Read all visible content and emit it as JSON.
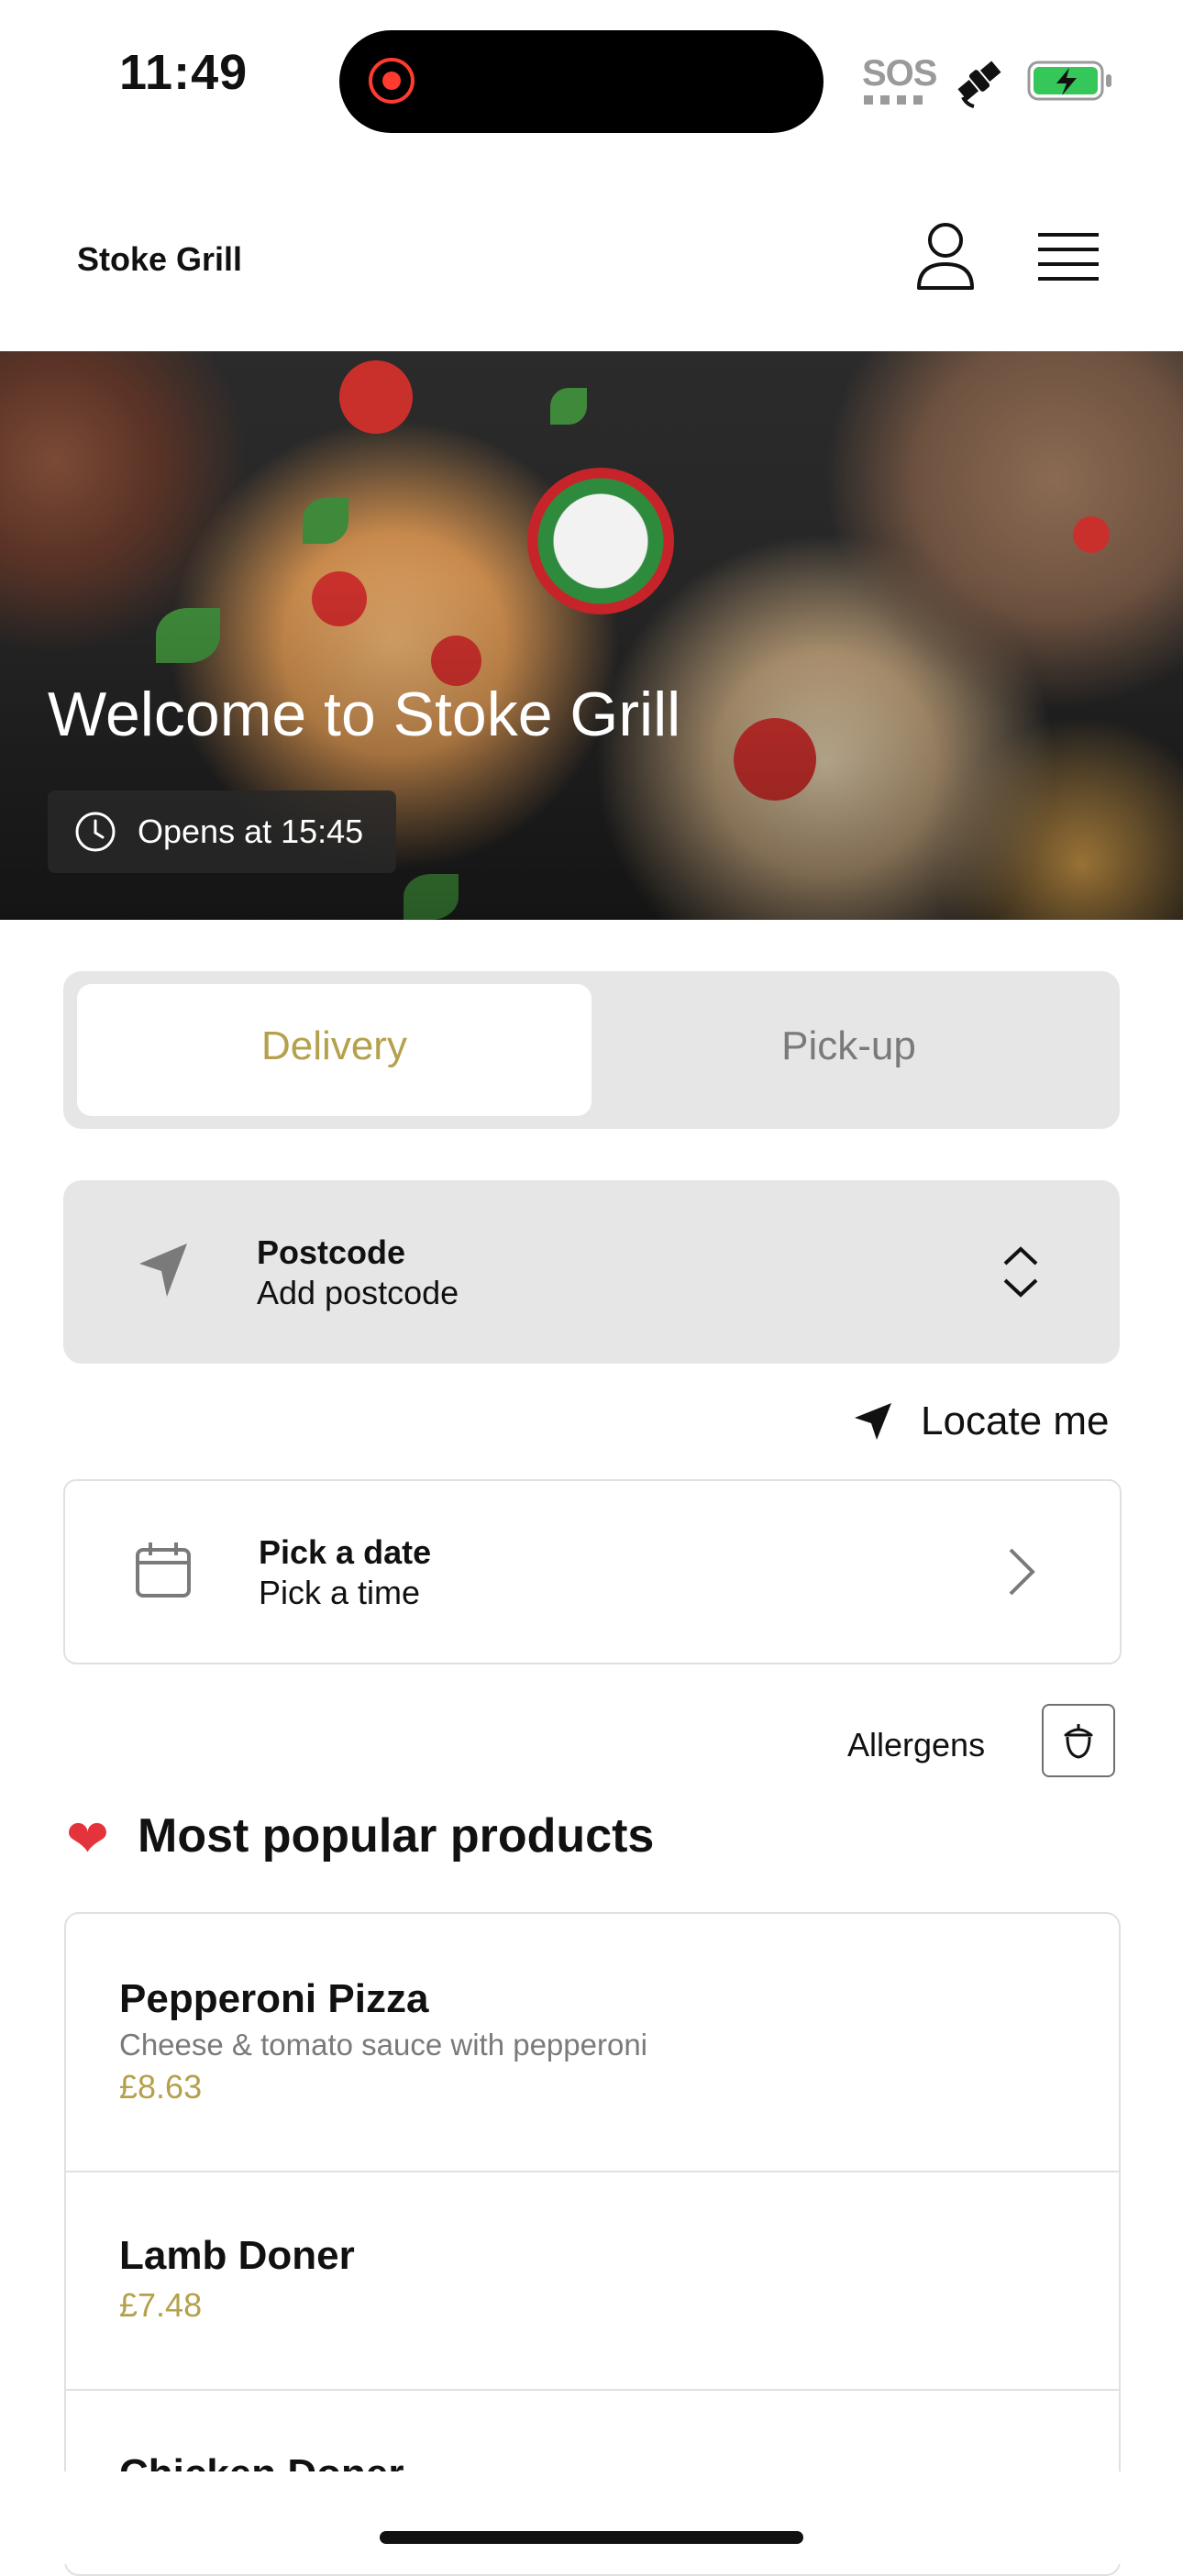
{
  "status_bar": {
    "time": "11:49",
    "sos": "SOS"
  },
  "header": {
    "brand": "Stoke Grill"
  },
  "hero": {
    "welcome": "Welcome to Stoke Grill",
    "opens": "Opens at 15:45"
  },
  "order_type": {
    "tabs": [
      "Delivery",
      "Pick-up"
    ],
    "active": "Delivery"
  },
  "postcode": {
    "title": "Postcode",
    "value": "Add postcode"
  },
  "locate": {
    "label": "Locate me"
  },
  "schedule": {
    "date": "Pick a date",
    "time": "Pick a time"
  },
  "allergens": {
    "label": "Allergens"
  },
  "popular": {
    "heading": "Most popular products",
    "items": [
      {
        "name": "Pepperoni Pizza",
        "description": "Cheese & tomato sauce with pepperoni",
        "price": "£8.63"
      },
      {
        "name": "Lamb Doner",
        "price": "£7.48"
      },
      {
        "name": "Chicken Doner"
      }
    ]
  },
  "colors": {
    "accent": "#b5a04b",
    "panel": "#e6e6e6",
    "border": "#e0e0e0"
  },
  "icons": [
    "record-icon",
    "satellite-icon",
    "battery-icon",
    "user-icon",
    "menu-icon",
    "clock-icon",
    "navigation-arrow-icon",
    "chevron-up-down-icon",
    "location-arrow-icon",
    "calendar-icon",
    "chevron-right-icon",
    "allergen-icon",
    "heart-icon"
  ]
}
